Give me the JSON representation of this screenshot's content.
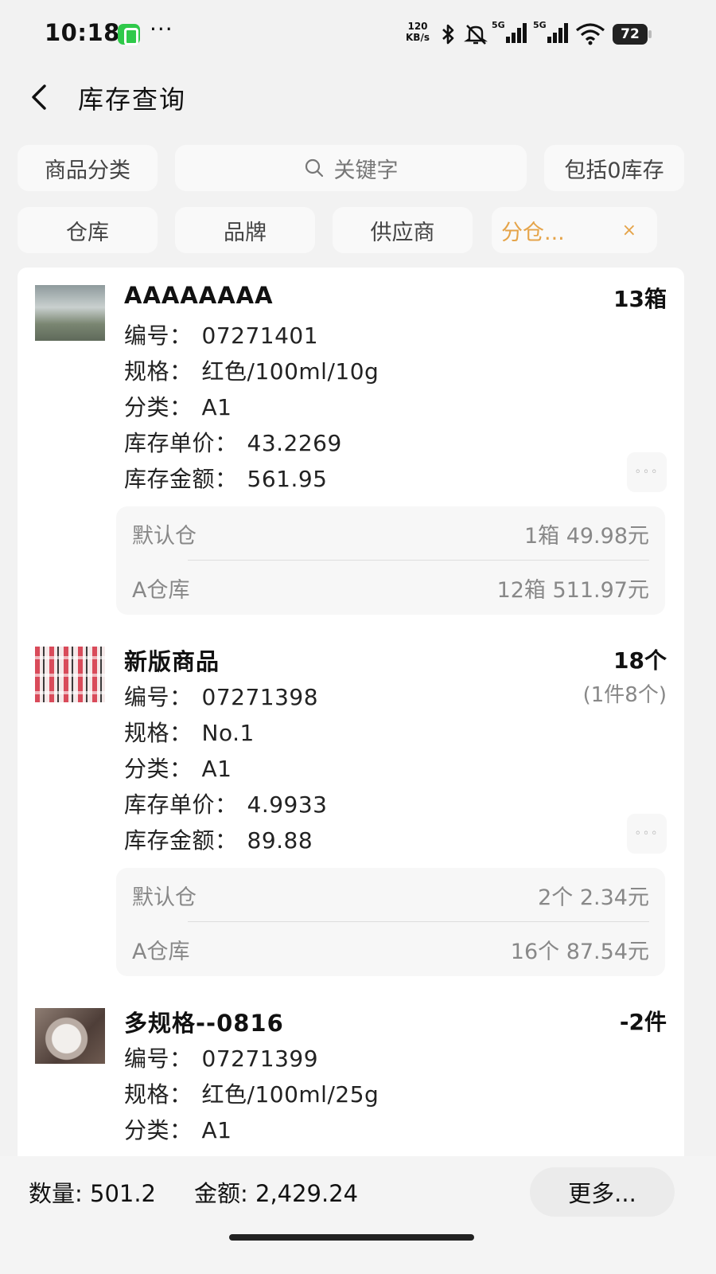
{
  "status_bar": {
    "time": "10:18",
    "more": "···",
    "net_speed_value": "120",
    "net_speed_unit": "KB/s",
    "signal_label_1": "5G",
    "signal_label_2": "5G",
    "battery": "72",
    "icons": [
      "speed-app-icon",
      "bluetooth-icon",
      "mute-icon",
      "signal-5g-icon",
      "signal-5g-icon",
      "wifi-icon",
      "battery-icon"
    ]
  },
  "header": {
    "title": "库存查询",
    "back_icon": "chevron-left-icon"
  },
  "filters": {
    "category": "商品分类",
    "search_placeholder": "关键字",
    "include_zero": "包括0库存",
    "warehouse": "仓库",
    "brand": "品牌",
    "supplier": "供应商",
    "split_warehouse": "分仓...",
    "close": "×",
    "accent_color": "#e5a44a"
  },
  "labels": {
    "code": "编号：",
    "spec": "规格：",
    "category": "分类：",
    "unit_price": "库存单价：",
    "amount": "库存金额：",
    "more": "◦◦◦"
  },
  "products": [
    {
      "name": "AAAAAAAA",
      "qty": "13箱",
      "code": "07271401",
      "spec": "红色/100ml/10g",
      "category": "A1",
      "unit_price": "43.2269",
      "amount": "561.95",
      "warehouses": [
        {
          "name": "默认仓",
          "value": "1箱 49.98元"
        },
        {
          "name": "A仓库",
          "value": "12箱 511.97元"
        }
      ]
    },
    {
      "name": "新版商品",
      "qty": "18个",
      "qty_sub": "(1件8个)",
      "code": "07271398",
      "spec": "No.1",
      "category": "A1",
      "unit_price": "4.9933",
      "amount": "89.88",
      "warehouses": [
        {
          "name": "默认仓",
          "value": "2个 2.34元"
        },
        {
          "name": "A仓库",
          "value": "16个 87.54元"
        }
      ]
    },
    {
      "name": "多规格--0816",
      "qty": "-2件",
      "code": "07271399",
      "spec": "红色/100ml/25g",
      "category": "A1"
    }
  ],
  "footer": {
    "qty": "数量: 501.2",
    "amount": "金额: 2,429.24",
    "more": "更多..."
  }
}
